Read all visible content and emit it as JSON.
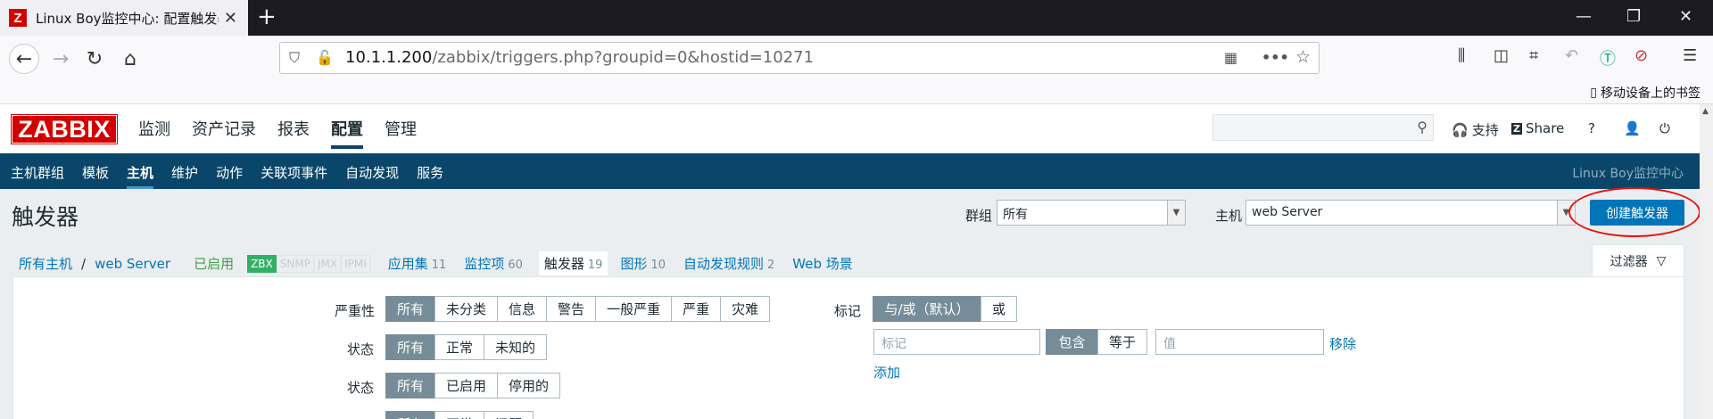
{
  "browser": {
    "tab_title": "Linux Boy监控中心: 配置触发器",
    "favicon_letter": "Z",
    "url_host": "10.1.1.200",
    "url_path": "/zabbix/triggers.php?groupid=0&hostid=10271",
    "bookmark_label": "移动设备上的书签"
  },
  "header": {
    "logo": "ZABBIX",
    "menu": [
      "监测",
      "资产记录",
      "报表",
      "配置",
      "管理"
    ],
    "support": "支持",
    "share": "Share",
    "help": "?"
  },
  "submenu": {
    "items": [
      "主机群组",
      "模板",
      "主机",
      "维护",
      "动作",
      "关联项事件",
      "自动发现",
      "服务"
    ],
    "server_name": "Linux Boy监控中心"
  },
  "page": {
    "title": "触发器",
    "group_label": "群组",
    "group_value": "所有",
    "host_label": "主机",
    "host_value": "web Server",
    "create_button": "创建触发器"
  },
  "host_nav": {
    "all_hosts": "所有主机",
    "separator": "/",
    "host": "web Server",
    "status": "已启用",
    "availability": [
      "ZBX",
      "SNMP",
      "JMX",
      "IPMI"
    ],
    "applications": {
      "label": "应用集",
      "count": "11"
    },
    "items": {
      "label": "监控项",
      "count": "60"
    },
    "triggers": {
      "label": "触发器",
      "count": "19"
    },
    "graphs": {
      "label": "图形",
      "count": "10"
    },
    "discovery": {
      "label": "自动发现规则",
      "count": "2"
    },
    "web": {
      "label": "Web 场景"
    }
  },
  "filter": {
    "tab_label": "过滤器",
    "severity_label": "严重性",
    "severity_options": [
      "所有",
      "未分类",
      "信息",
      "警告",
      "一般严重",
      "严重",
      "灾难"
    ],
    "state_label": "状态",
    "state_options": [
      "所有",
      "正常",
      "未知的"
    ],
    "status_label": "状态",
    "status_options": [
      "所有",
      "已启用",
      "停用的"
    ],
    "value_options": [
      "所有",
      "正常",
      "问题"
    ],
    "tags_label": "标记",
    "tags_mode": [
      "与/或（默认）",
      "或"
    ],
    "tag_placeholder": "标记",
    "operator_options": [
      "包含",
      "等于"
    ],
    "value_placeholder": "值",
    "remove_link": "移除",
    "add_link": "添加"
  }
}
